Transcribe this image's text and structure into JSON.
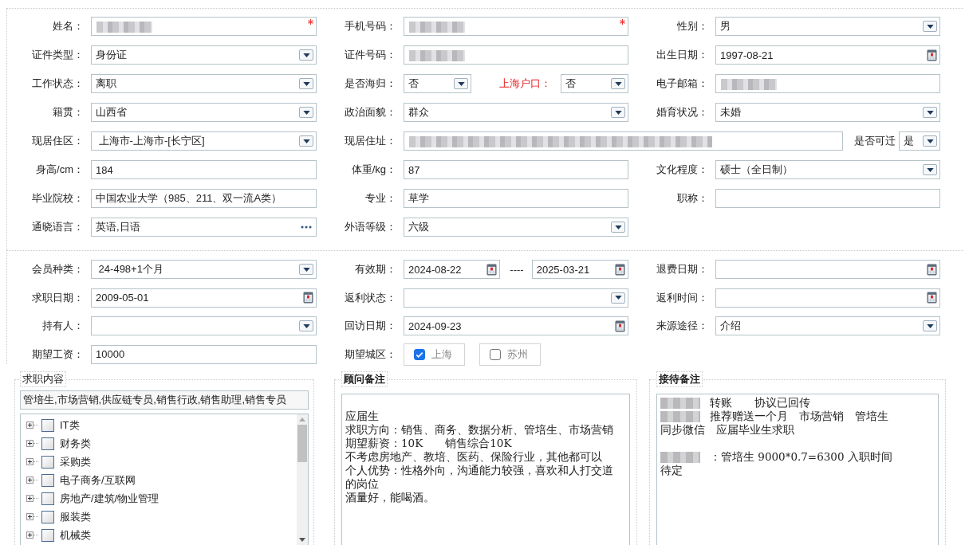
{
  "profile_rows": [
    [
      {
        "label": "姓名：",
        "fields": [
          {
            "kind": "text",
            "redacted": true,
            "required": true
          }
        ]
      },
      {
        "label": "手机号码：",
        "fields": [
          {
            "kind": "text",
            "redacted": true,
            "required": true
          }
        ]
      },
      {
        "label": "性别：",
        "fields": [
          {
            "kind": "select",
            "value": "男"
          }
        ]
      }
    ],
    [
      {
        "label": "证件类型：",
        "fields": [
          {
            "kind": "select",
            "value": "身份证"
          }
        ]
      },
      {
        "label": "证件号码：",
        "fields": [
          {
            "kind": "text",
            "redacted": true
          }
        ]
      },
      {
        "label": "出生日期：",
        "fields": [
          {
            "kind": "date",
            "value": "1997-08-21"
          }
        ]
      }
    ],
    [
      {
        "label": "工作状态：",
        "fields": [
          {
            "kind": "select",
            "value": "离职"
          }
        ]
      },
      {
        "label": "是否海归：",
        "fields": [
          {
            "kind": "select",
            "value": "否"
          },
          {
            "kind": "label",
            "value": "上海户口：",
            "highlight": true
          },
          {
            "kind": "select",
            "value": "否"
          }
        ]
      },
      {
        "label": "电子邮箱：",
        "fields": [
          {
            "kind": "text",
            "redacted": true
          }
        ]
      }
    ],
    [
      {
        "label": "籍贯：",
        "fields": [
          {
            "kind": "select",
            "value": "山西省"
          }
        ]
      },
      {
        "label": "政治面貌：",
        "fields": [
          {
            "kind": "select",
            "value": "群众"
          }
        ]
      },
      {
        "label": "婚育状况：",
        "fields": [
          {
            "kind": "select",
            "value": "未婚"
          }
        ]
      }
    ],
    [
      {
        "label": "现居住区：",
        "fields": [
          {
            "kind": "select",
            "value": " 上海市-上海市-[长宁区]"
          }
        ]
      },
      {
        "label": "现居住址：",
        "wide": true,
        "fields": [
          {
            "kind": "text",
            "redacted": true
          },
          {
            "kind": "label",
            "value": "是否可迁",
            "highlight": false
          },
          {
            "kind": "select",
            "value": "是"
          }
        ]
      }
    ],
    [
      {
        "label": "身高/cm：",
        "fields": [
          {
            "kind": "text",
            "value": "184"
          }
        ]
      },
      {
        "label": "体重/kg：",
        "fields": [
          {
            "kind": "text",
            "value": "87"
          }
        ]
      },
      {
        "label": "文化程度：",
        "fields": [
          {
            "kind": "select",
            "value": "硕士（全日制）"
          }
        ]
      }
    ],
    [
      {
        "label": "毕业院校：",
        "fields": [
          {
            "kind": "text",
            "value": "中国农业大学（985、211、双一流A类）"
          }
        ]
      },
      {
        "label": "专业：",
        "fields": [
          {
            "kind": "text",
            "value": "草学"
          }
        ]
      },
      {
        "label": "职称：",
        "fields": [
          {
            "kind": "text"
          }
        ]
      }
    ],
    [
      {
        "label": "通晓语言：",
        "fields": [
          {
            "kind": "picker",
            "value": "英语,日语"
          }
        ]
      },
      {
        "label": "外语等级：",
        "fields": [
          {
            "kind": "select",
            "value": "六级"
          }
        ]
      }
    ]
  ],
  "member_rows": [
    [
      {
        "label": "会员种类：",
        "fields": [
          {
            "kind": "select",
            "value": " 24-498+1个月"
          }
        ]
      },
      {
        "label": "有效期：",
        "fields": [
          {
            "kind": "date",
            "value": "2024-08-22"
          },
          {
            "kind": "label",
            "value": "----",
            "highlight": false
          },
          {
            "kind": "date",
            "value": "2025-03-21"
          }
        ]
      },
      {
        "label": "退费日期：",
        "fields": [
          {
            "kind": "date"
          }
        ]
      }
    ],
    [
      {
        "label": "求职日期：",
        "fields": [
          {
            "kind": "date",
            "value": "2009-05-01"
          }
        ]
      },
      {
        "label": "返利状态：",
        "fields": [
          {
            "kind": "select"
          }
        ]
      },
      {
        "label": "返利时间：",
        "fields": [
          {
            "kind": "date"
          }
        ]
      }
    ],
    [
      {
        "label": "持有人：",
        "fields": [
          {
            "kind": "select"
          }
        ]
      },
      {
        "label": "回访日期：",
        "fields": [
          {
            "kind": "date",
            "value": "2024-09-23"
          }
        ]
      },
      {
        "label": "来源途径：",
        "fields": [
          {
            "kind": "select",
            "value": "介绍"
          }
        ]
      }
    ],
    [
      {
        "label": "期望工资：",
        "fields": [
          {
            "kind": "text",
            "value": "10000"
          }
        ]
      },
      {
        "label": "期望城区：",
        "fields": [
          {
            "kind": "checkbox",
            "value": "上海",
            "checked": true
          },
          {
            "kind": "checkbox",
            "value": "苏州",
            "checked": false
          }
        ]
      }
    ]
  ],
  "job_intent": {
    "title": "求职内容",
    "summary": "管培生,市场营销,供应链专员,销售行政,销售助理,销售专员",
    "categories": [
      {
        "label": "IT类",
        "checked": false,
        "expanded": false
      },
      {
        "label": "财务类",
        "checked": false,
        "expanded": false
      },
      {
        "label": "采购类",
        "checked": false,
        "expanded": false
      },
      {
        "label": "电子商务/互联网",
        "checked": false,
        "expanded": false
      },
      {
        "label": "房地产/建筑/物业管理",
        "checked": false,
        "expanded": false
      },
      {
        "label": "服装类",
        "checked": false,
        "expanded": false
      },
      {
        "label": "机械类",
        "checked": false,
        "expanded": false
      }
    ]
  },
  "consultant_note": {
    "title": "顾问备注",
    "lines": [
      {
        "kind": "blank"
      },
      {
        "kind": "text",
        "text": "应届生"
      },
      {
        "kind": "text",
        "text": "求职方向：销售、商务、数据分析、管培生、市场营销"
      },
      {
        "kind": "text",
        "text": "期望薪资：10K　　销售综合10K"
      },
      {
        "kind": "text",
        "text": "不考虑房地产、教培、医药、保险行业，其他都可以"
      },
      {
        "kind": "text",
        "text": "个人优势：性格外向，沟通能力较强，喜欢和人打交道"
      },
      {
        "kind": "text",
        "text": "的岗位"
      },
      {
        "kind": "text",
        "text": "酒量好，能喝酒。"
      }
    ]
  },
  "reception_note": {
    "title": "接待备注",
    "lines": [
      {
        "kind": "text",
        "text": "转账　　协议已回传",
        "redacted": true
      },
      {
        "kind": "text",
        "text": "推荐赠送一个月　市场营销　管培生",
        "redacted": true
      },
      {
        "kind": "text",
        "text": "同步微信　应届毕业生求职"
      },
      {
        "kind": "blank"
      },
      {
        "kind": "text",
        "text": "：管培生 9000*0.7=6300 入职时间",
        "redacted": true
      },
      {
        "kind": "text",
        "text": "待定"
      }
    ]
  }
}
